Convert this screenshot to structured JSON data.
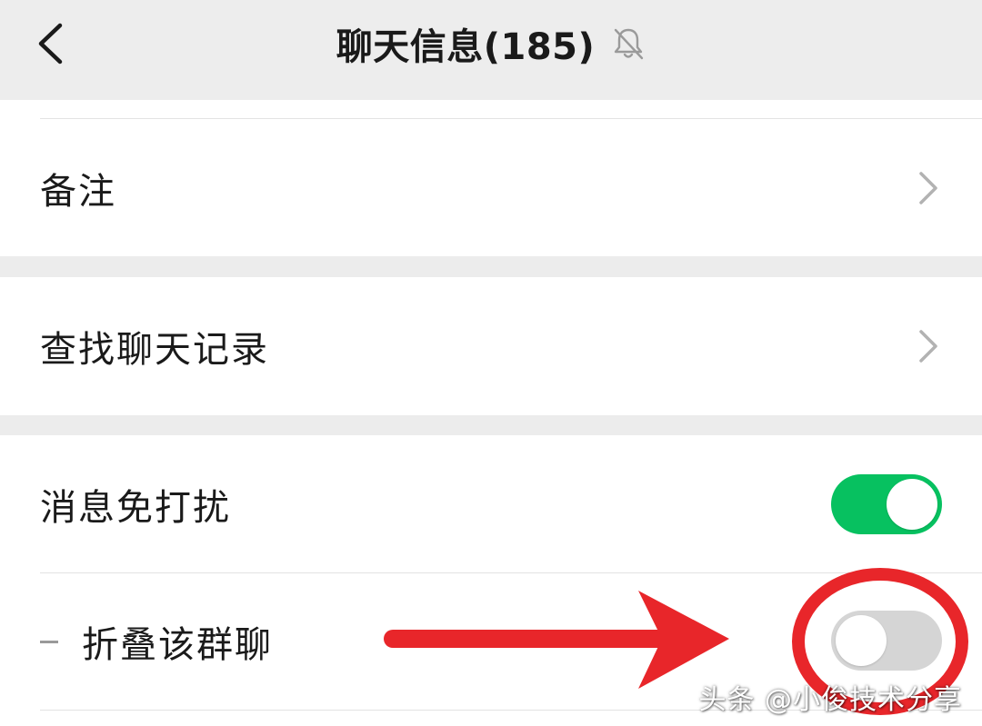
{
  "header": {
    "title": "聊天信息(185)",
    "back_icon": "chevron-left-icon",
    "status_icon": "bell-muted-icon"
  },
  "rows": {
    "remark": {
      "label": "备注"
    },
    "search_history": {
      "label": "查找聊天记录"
    },
    "mute": {
      "label": "消息免打扰",
      "enabled": true
    },
    "fold": {
      "label": "折叠该群聊",
      "enabled": false
    }
  },
  "colors": {
    "toggle_on": "#07c160",
    "toggle_off": "#d5d5d5",
    "annotation": "#e8262a"
  },
  "annotation": {
    "type": "red-arrow-and-circle",
    "target": "fold-toggle"
  },
  "watermark": "头条 @小俊技术分享"
}
